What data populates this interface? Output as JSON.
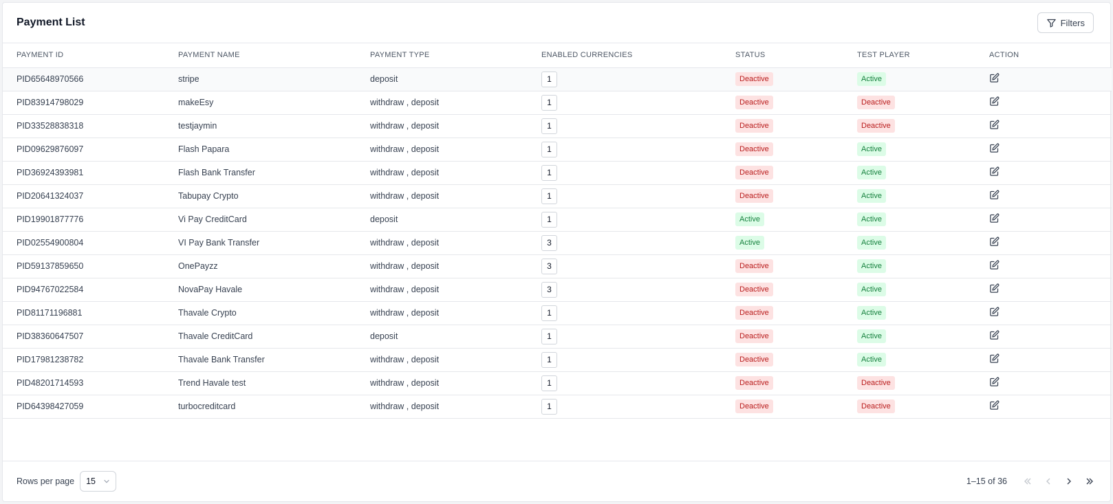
{
  "header": {
    "title": "Payment List",
    "filters_label": "Filters"
  },
  "columns": [
    "PAYMENT ID",
    "PAYMENT NAME",
    "PAYMENT TYPE",
    "ENABLED CURRENCIES",
    "STATUS",
    "TEST PLAYER",
    "ACTION"
  ],
  "rows": [
    {
      "id": "PID65648970566",
      "name": "stripe",
      "type": "deposit",
      "currencies": "1",
      "status": "Deactive",
      "test_player": "Active"
    },
    {
      "id": "PID83914798029",
      "name": "makeEsy",
      "type": "withdraw , deposit",
      "currencies": "1",
      "status": "Deactive",
      "test_player": "Deactive"
    },
    {
      "id": "PID33528838318",
      "name": "testjaymin",
      "type": "withdraw , deposit",
      "currencies": "1",
      "status": "Deactive",
      "test_player": "Deactive"
    },
    {
      "id": "PID09629876097",
      "name": "Flash Papara",
      "type": "withdraw , deposit",
      "currencies": "1",
      "status": "Deactive",
      "test_player": "Active"
    },
    {
      "id": "PID36924393981",
      "name": "Flash Bank Transfer",
      "type": "withdraw , deposit",
      "currencies": "1",
      "status": "Deactive",
      "test_player": "Active"
    },
    {
      "id": "PID20641324037",
      "name": "Tabupay Crypto",
      "type": "withdraw , deposit",
      "currencies": "1",
      "status": "Deactive",
      "test_player": "Active"
    },
    {
      "id": "PID19901877776",
      "name": "Vi Pay CreditCard",
      "type": "deposit",
      "currencies": "1",
      "status": "Active",
      "test_player": "Active"
    },
    {
      "id": "PID02554900804",
      "name": "VI Pay Bank Transfer",
      "type": "withdraw , deposit",
      "currencies": "3",
      "status": "Active",
      "test_player": "Active"
    },
    {
      "id": "PID59137859650",
      "name": "OnePayzz",
      "type": "withdraw , deposit",
      "currencies": "3",
      "status": "Deactive",
      "test_player": "Active"
    },
    {
      "id": "PID94767022584",
      "name": "NovaPay Havale",
      "type": "withdraw , deposit",
      "currencies": "3",
      "status": "Deactive",
      "test_player": "Active"
    },
    {
      "id": "PID81171196881",
      "name": "Thavale Crypto",
      "type": "withdraw , deposit",
      "currencies": "1",
      "status": "Deactive",
      "test_player": "Active"
    },
    {
      "id": "PID38360647507",
      "name": "Thavale CreditCard",
      "type": "deposit",
      "currencies": "1",
      "status": "Deactive",
      "test_player": "Active"
    },
    {
      "id": "PID17981238782",
      "name": "Thavale Bank Transfer",
      "type": "withdraw , deposit",
      "currencies": "1",
      "status": "Deactive",
      "test_player": "Active"
    },
    {
      "id": "PID48201714593",
      "name": "Trend Havale test",
      "type": "withdraw , deposit",
      "currencies": "1",
      "status": "Deactive",
      "test_player": "Deactive"
    },
    {
      "id": "PID64398427059",
      "name": "turbocreditcard",
      "type": "withdraw , deposit",
      "currencies": "1",
      "status": "Deactive",
      "test_player": "Deactive"
    }
  ],
  "footer": {
    "rows_per_page_label": "Rows per page",
    "rows_per_page_value": "15",
    "range_text": "1–15 of 36"
  },
  "colors": {
    "deactive_bg": "#fde2e2",
    "deactive_text": "#b91c1c",
    "active_bg": "#dcfce7",
    "active_text": "#15803d"
  },
  "icons": {
    "filters": "filter-icon",
    "action": "edit-icon",
    "select": "chevron-down-icon",
    "pager": [
      "first-page-icon",
      "prev-page-icon",
      "next-page-icon",
      "last-page-icon"
    ]
  }
}
